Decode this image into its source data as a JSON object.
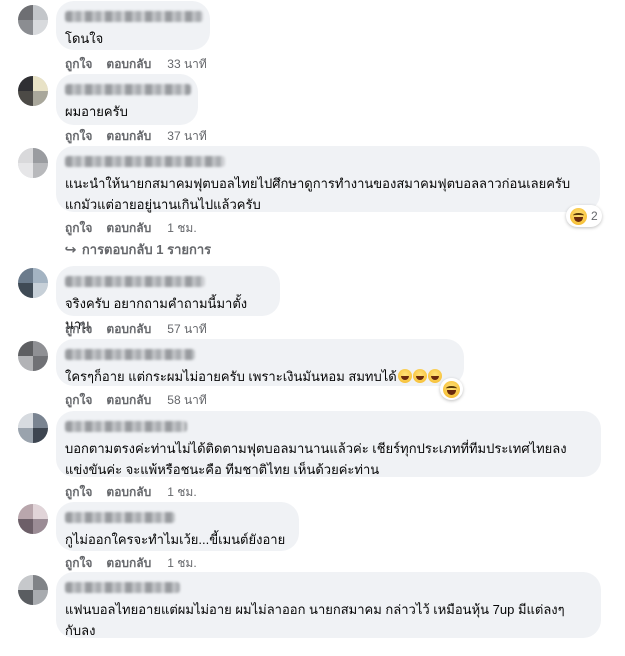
{
  "action_labels": {
    "like": "ถูกใจ",
    "reply": "ตอบกลับ"
  },
  "comments": [
    {
      "text": "โดนใจ",
      "time": "33 นาที"
    },
    {
      "text": "ผมอายครับ",
      "time": "37 นาที"
    },
    {
      "text": "แนะนำให้นายกสมาคมฟุตบอลไทยไปศึกษาดูการทำงานของสมาคมฟุตบอลลาวก่อนเลยครับ\nแกมัวแต่อายอยู่นานเกินไปแล้วครับ",
      "time": "1 ชม.",
      "reaction_count": "2",
      "reply_link": "การตอบกลับ 1 รายการ"
    },
    {
      "text": "จริงครับ อยากถามคำถามนี้มาตั้งนาน",
      "time": "57 นาที"
    },
    {
      "text": "ใครๆก็อาย แต่กระผมไม่อายครับ เพราะเงินมันหอม สมทบได้",
      "time": "58 นาที"
    },
    {
      "text": "บอกตามตรงค่ะท่านไม่ได้ติดตามฟุตบอลมานานแล้วค่ะ เชียร์ทุกประเภทที่ทีมประเทศไทยลง\nแข่งขันค่ะ จะแพ้หรือชนะคือ ทีมชาติไทย เห็นด้วยค่ะท่าน",
      "time": "1 ชม."
    },
    {
      "text": "กูไม่ออกใครจะทำไมเว้ย...ขี้เมนต์ยังอาย",
      "time": "1 ชม."
    },
    {
      "text": "แฟนบอลไทยอายแต่ผมไม่อาย ผมไม่ลาออก นายกสมาคม กล่าวไว้ เหมือนหุ้น 7up มีแต่ลงๆ\nกับลง"
    }
  ],
  "icons": {
    "reaction": "haha-emoji-icon",
    "reply_arrow": "reply-arrow-icon"
  }
}
